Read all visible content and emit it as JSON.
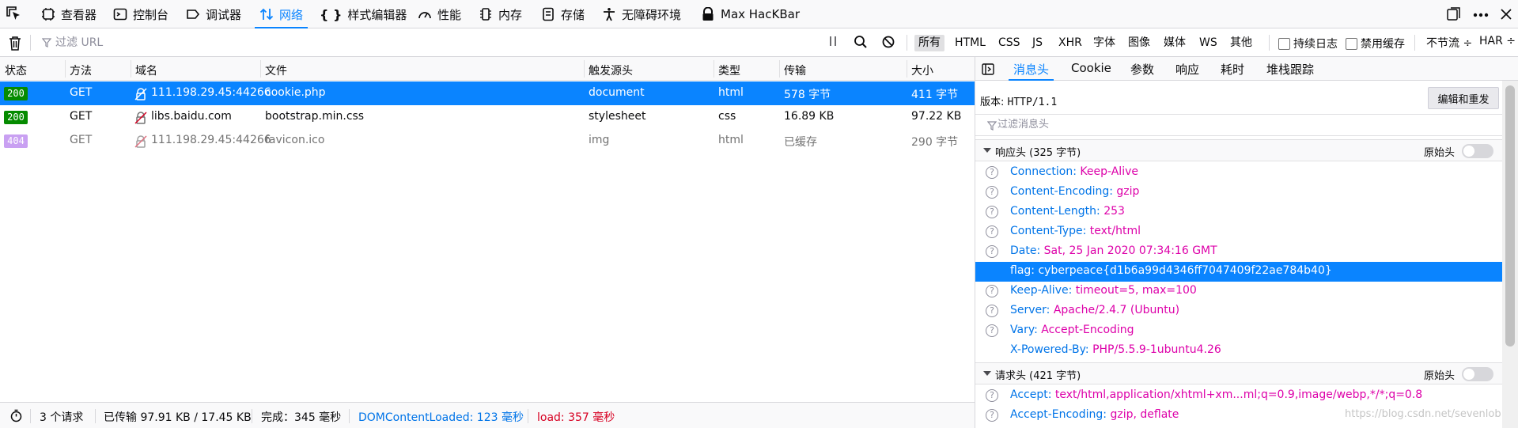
{
  "toolbar": {
    "tabs": [
      {
        "label": "查看器",
        "icon": "inspector-icon"
      },
      {
        "label": "控制台",
        "icon": "console-icon"
      },
      {
        "label": "调试器",
        "icon": "debugger-icon"
      },
      {
        "label": "网络",
        "icon": "network-arrows-icon"
      },
      {
        "label": "样式编辑器",
        "icon": "braces-icon"
      },
      {
        "label": "性能",
        "icon": "gauge-icon"
      },
      {
        "label": "内存",
        "icon": "memory-chip-icon"
      },
      {
        "label": "存储",
        "icon": "storage-icon"
      },
      {
        "label": "无障碍环境",
        "icon": "accessibility-person-icon"
      },
      {
        "label": "Max HacKBar",
        "icon": "hackbar-lock-icon"
      }
    ],
    "active_tab": "网络"
  },
  "filterbar": {
    "url_placeholder": "过滤 URL",
    "type_filters": [
      "所有",
      "HTML",
      "CSS",
      "JS",
      "XHR",
      "字体",
      "图像",
      "媒体",
      "WS",
      "其他"
    ],
    "persist_logs_label": "持续日志",
    "disable_cache_label": "禁用缓存",
    "throttle_label": "不节流 ÷",
    "har_label": "HAR ÷"
  },
  "requests": {
    "columns": [
      "状态",
      "方法",
      "域名",
      "文件",
      "触发源头",
      "类型",
      "传输",
      "大小"
    ],
    "rows": [
      {
        "status": "200",
        "method": "GET",
        "domain": "111.198.29.45:44266",
        "file": "cookie.php",
        "cause": "document",
        "type": "html",
        "transferred": "578 字节",
        "size": "411 字节"
      },
      {
        "status": "200",
        "method": "GET",
        "domain": "libs.baidu.com",
        "file": "bootstrap.min.css",
        "cause": "stylesheet",
        "type": "css",
        "transferred": "16.89 KB",
        "size": "97.22 KB"
      },
      {
        "status": "404",
        "method": "GET",
        "domain": "111.198.29.45:44266",
        "file": "favicon.ico",
        "cause": "img",
        "type": "html",
        "transferred": "已缓存",
        "size": "290 字节"
      }
    ]
  },
  "footer": {
    "requests_count": "3 个请求",
    "transferred": "已传输 97.91 KB / 17.45 KB",
    "finish": "完成：345 毫秒",
    "dom_loaded": "DOMContentLoaded: 123 毫秒",
    "load": "load: 357 毫秒"
  },
  "details": {
    "tabs": [
      "消息头",
      "Cookie",
      "参数",
      "响应",
      "耗时",
      "堆栈跟踪"
    ],
    "active_tab": "消息头",
    "version_label": "版本:",
    "version_value": "HTTP/1.1",
    "edit_resend_label": "编辑和重发",
    "filter_placeholder": "过滤消息头",
    "response_section": "响应头 (325 字节)",
    "raw_label": "原始头",
    "response_headers": [
      {
        "name": "Connection:",
        "value": "Keep-Alive"
      },
      {
        "name": "Content-Encoding:",
        "value": "gzip"
      },
      {
        "name": "Content-Length:",
        "value": "253"
      },
      {
        "name": "Content-Type:",
        "value": "text/html"
      },
      {
        "name": "Date:",
        "value": "Sat, 25 Jan 2020 07:34:16 GMT"
      },
      {
        "name": "flag:",
        "value": "cyberpeace{d1b6a99d4346ff7047409f22ae784b40}"
      },
      {
        "name": "Keep-Alive:",
        "value": "timeout=5, max=100"
      },
      {
        "name": "Server:",
        "value": "Apache/2.4.7 (Ubuntu)"
      },
      {
        "name": "Vary:",
        "value": "Accept-Encoding"
      },
      {
        "name": "X-Powered-By:",
        "value": "PHP/5.5.9-1ubuntu4.26"
      }
    ],
    "request_section": "请求头 (421 字节)",
    "request_headers": [
      {
        "name": "Accept:",
        "value": "text/html,application/xhtml+xm...ml;q=0.9,image/webp,*/*;q=0.8"
      },
      {
        "name": "Accept-Encoding:",
        "value": "gzip, deflate"
      }
    ]
  },
  "watermark": "https://blog.csdn.net/sevenlob",
  "colors": {
    "accent": "#0a84ff",
    "status_ok": "#058b00",
    "status_404": "#c9a0f2",
    "header_name": "#0074e8",
    "header_value": "#dd00a9"
  }
}
